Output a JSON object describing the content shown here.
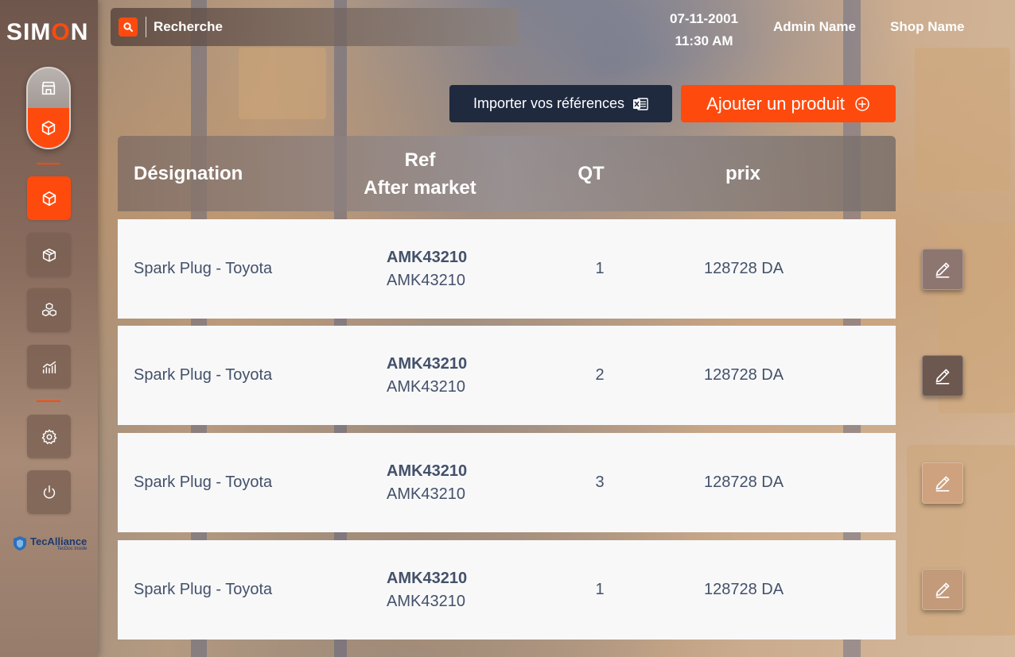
{
  "brand": {
    "logo_prefix": "SIM",
    "logo_o": "O",
    "logo_suffix": "N",
    "accent": "#ff4a0e"
  },
  "search": {
    "label": "Recherche"
  },
  "header": {
    "date": "07-11-2001",
    "time": "11:30 AM",
    "admin": "Admin Name",
    "shop": "Shop Name"
  },
  "actions": {
    "import_label": "Importer vos références",
    "add_label": "Ajouter un produit"
  },
  "table": {
    "columns": {
      "designation": "Désignation",
      "ref_line1": "Ref",
      "ref_line2": "After market",
      "qt": "QT",
      "prix": "prix"
    },
    "rows": [
      {
        "designation": "Spark Plug - Toyota",
        "ref_main": "AMK43210",
        "ref_sub": "AMK43210",
        "qt": "1",
        "prix": "128728 DA"
      },
      {
        "designation": "Spark Plug - Toyota",
        "ref_main": "AMK43210",
        "ref_sub": "AMK43210",
        "qt": "2",
        "prix": "128728 DA"
      },
      {
        "designation": "Spark Plug - Toyota",
        "ref_main": "AMK43210",
        "ref_sub": "AMK43210",
        "qt": "3",
        "prix": "128728 DA"
      },
      {
        "designation": "Spark Plug - Toyota",
        "ref_main": "AMK43210",
        "ref_sub": "AMK43210",
        "qt": "1",
        "prix": "128728 DA"
      }
    ]
  },
  "partner": {
    "name": "TecAlliance",
    "sub": "TecDoc Inside"
  }
}
